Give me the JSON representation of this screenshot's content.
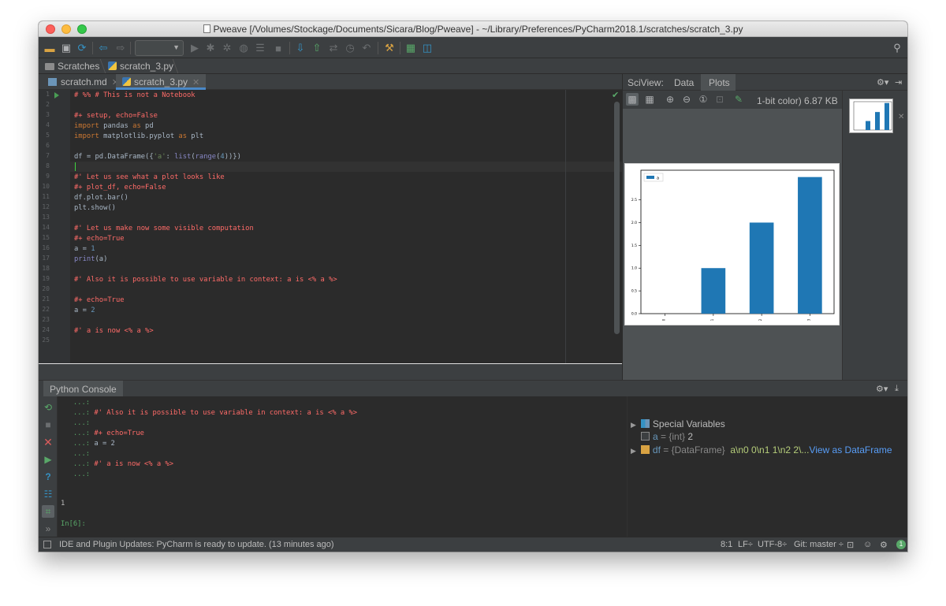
{
  "window": {
    "title": "Pweave [/Volumes/Stockage/Documents/Sicara/Blog/Pweave] - ~/Library/Preferences/PyCharm2018.1/scratches/scratch_3.py"
  },
  "breadcrumb": {
    "items": [
      "Scratches",
      "scratch_3.py"
    ]
  },
  "editor_tabs": [
    {
      "label": "scratch.md",
      "active": false
    },
    {
      "label": "scratch_3.py",
      "active": true
    }
  ],
  "editor": {
    "line_numbers": [
      "1",
      "2",
      "3",
      "4",
      "5",
      "6",
      "7",
      "8",
      "9",
      "10",
      "11",
      "12",
      "13",
      "14",
      "15",
      "16",
      "17",
      "18",
      "19",
      "20",
      "21",
      "22",
      "23",
      "24",
      "25"
    ],
    "lines": [
      "# %% # This is not a Notebook",
      "",
      "#+ setup, echo=False",
      "import pandas as pd",
      "import matplotlib.pyplot as plt",
      "",
      "df = pd.DataFrame({'a': list(range(4))})",
      "",
      "#' Let us see what a plot looks like",
      "#+ plot_df, echo=False",
      "df.plot.bar()",
      "plt.show()",
      "",
      "#' Let us make now some visible computation",
      "#+ echo=True",
      "a = 1",
      "print(a)",
      "",
      "#' Also it is possible to use variable in context: a is <% a %>",
      "",
      "#+ echo=True",
      "a = 2",
      "",
      "#' a is now <% a %>",
      ""
    ]
  },
  "sciview": {
    "label": "SciView:",
    "tabs": [
      "Data",
      "Plots"
    ],
    "active_tab": "Plots",
    "image_info": "1-bit color) 6.87 KB"
  },
  "chart_data": {
    "type": "bar",
    "categories": [
      "0",
      "1",
      "2",
      "3"
    ],
    "series": [
      {
        "name": "a",
        "values": [
          0,
          1,
          2,
          3
        ]
      }
    ],
    "yticks": [
      "0.0",
      "0.5",
      "1.0",
      "1.5",
      "2.0",
      "2.5"
    ],
    "ylim": [
      0,
      3.15
    ],
    "legend_position": "top-left",
    "bar_color": "#1f77b4",
    "grid": false
  },
  "console": {
    "tab_label": "Python Console",
    "lines": [
      {
        "prompt": "   ...:",
        "text": "",
        "style": "tx"
      },
      {
        "prompt": "   ...:",
        "text": " #' Also it is possible to use variable in context: a is <% a %>",
        "style": "cm"
      },
      {
        "prompt": "   ...:",
        "text": "",
        "style": "tx"
      },
      {
        "prompt": "   ...:",
        "text": " #+ echo=True",
        "style": "cm"
      },
      {
        "prompt": "   ...:",
        "text": " a = 2",
        "style": "tx"
      },
      {
        "prompt": "   ...:",
        "text": "",
        "style": "tx"
      },
      {
        "prompt": "   ...:",
        "text": " #' a is now <% a %>",
        "style": "cm"
      },
      {
        "prompt": "   ...:",
        "text": "",
        "style": "tx"
      }
    ],
    "output": "1",
    "input_prompt": "In[6]:"
  },
  "variables": {
    "special_label": "Special Variables",
    "items": [
      {
        "name": "a",
        "type": "= {int}",
        "value": "2",
        "expandable": false
      },
      {
        "name": "df",
        "type": "= {DataFrame}",
        "value": "a\\n0  0\\n1  1\\n2  2\\...",
        "link": "View as DataFrame",
        "expandable": true
      }
    ]
  },
  "statusbar": {
    "message": "IDE and Plugin Updates: PyCharm is ready to update. (13 minutes ago)",
    "position": "8:1",
    "line_sep": "LF÷",
    "encoding": "UTF-8÷",
    "vcs": "Git: master ÷",
    "notifications": "1"
  }
}
